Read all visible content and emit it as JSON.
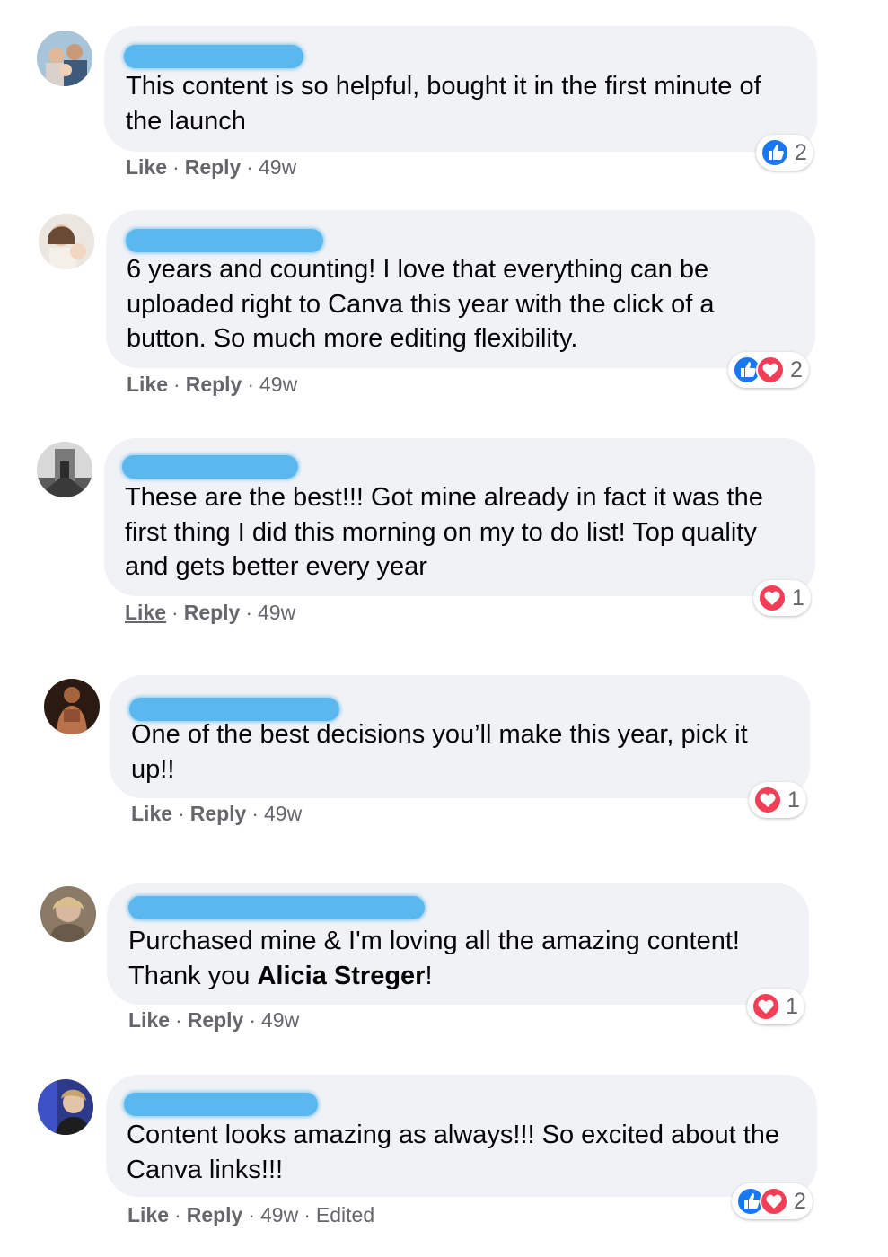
{
  "comments": [
    {
      "text": "This content is so helpful, bought it in the first minute of\nthe launch",
      "actions": {
        "like": "Like",
        "reply": "Reply",
        "time": "49w"
      },
      "reactions": {
        "icons": [
          "like-icon"
        ],
        "count": "2"
      }
    },
    {
      "text": "6 years and counting! I love that everything can be\nuploaded right to Canva this year with the click of a\nbutton. So much more editing flexibility.",
      "actions": {
        "like": "Like",
        "reply": "Reply",
        "time": "49w"
      },
      "reactions": {
        "icons": [
          "like-icon",
          "love-icon"
        ],
        "count": "2"
      }
    },
    {
      "text": "These are the best!!! Got mine already in fact it was the\nfirst thing I did this morning on my to do list! Top quality\nand gets better every year",
      "actions": {
        "like": "Like",
        "reply": "Reply",
        "time": "49w"
      },
      "reactions": {
        "icons": [
          "love-icon"
        ],
        "count": "1"
      }
    },
    {
      "text": "One of the best decisions you’ll make this year, pick it\nup!!",
      "actions": {
        "like": "Like",
        "reply": "Reply",
        "time": "49w"
      },
      "reactions": {
        "icons": [
          "love-icon"
        ],
        "count": "1"
      }
    },
    {
      "text_before": "Purchased mine & I'm loving all the amazing content!\nThank you ",
      "mention": "Alicia Streger",
      "text_after": "!",
      "actions": {
        "like": "Like",
        "reply": "Reply",
        "time": "49w"
      },
      "reactions": {
        "icons": [
          "love-icon"
        ],
        "count": "1"
      }
    },
    {
      "text": "Content looks amazing as always!!! So excited about the\nCanva links!!!",
      "actions": {
        "like": "Like",
        "reply": "Reply",
        "time": "49w",
        "edited": "Edited"
      },
      "reactions": {
        "icons": [
          "like-icon",
          "love-icon"
        ],
        "count": "2"
      }
    }
  ],
  "colors": {
    "bubble": "#f0f2f5",
    "redaction": "#5bb8ee",
    "like_blue": "#1877f2",
    "love_red": "#f33e58",
    "meta_gray": "#65676b"
  }
}
